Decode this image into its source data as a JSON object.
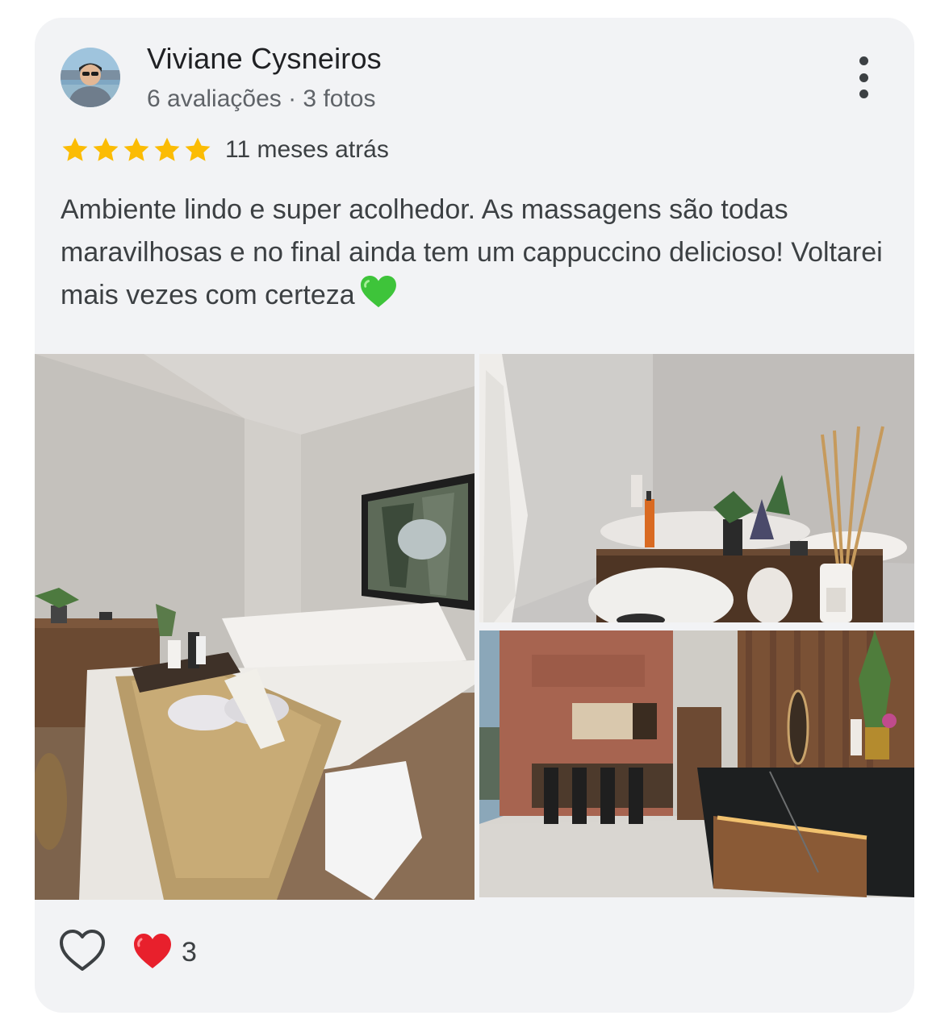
{
  "review": {
    "author_name": "Viviane Cysneiros",
    "author_meta": "6 avaliações · 3 fotos",
    "rating": 5,
    "rating_max": 5,
    "time": "11 meses atrás",
    "text": "Ambiente lindo e super acolhedor. As massagens são todas maravilhosas e no final ainda tem um cappuccino delicioso! Voltarei mais vezes com certeza",
    "text_emoji": "green-heart-icon"
  },
  "photos": [
    {
      "name": "massage-room-photo"
    },
    {
      "name": "reception-detail-photo"
    },
    {
      "name": "lobby-photo"
    }
  ],
  "reactions": {
    "like_icon": "heart-outline-icon",
    "reaction_icon": "red-heart-icon",
    "count": "3"
  },
  "colors": {
    "card_background": "#f2f3f5",
    "star": "#fbbc04",
    "text_primary": "#202124",
    "text_secondary": "#5f6368",
    "reaction_heart": "#e8202c",
    "emoji_heart": "#3ec43a"
  }
}
